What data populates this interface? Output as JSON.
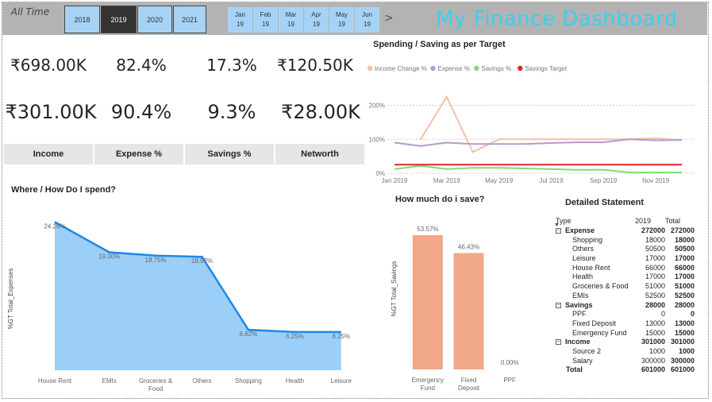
{
  "header": {
    "all_time": "All Time",
    "years": [
      "2018",
      "2019",
      "2020",
      "2021"
    ],
    "active_year": "2019",
    "months": [
      {
        "m": "Jan",
        "y": "19"
      },
      {
        "m": "Feb",
        "y": "19"
      },
      {
        "m": "Mar",
        "y": "19"
      },
      {
        "m": "Apr",
        "y": "19"
      },
      {
        "m": "May",
        "y": "19"
      },
      {
        "m": "Jun",
        "y": "19"
      }
    ],
    "next_arrow": ">",
    "title": "My Finance Dashboard"
  },
  "kpis": {
    "row1": [
      "₹698.00K",
      "82.4%",
      "17.3%",
      "₹120.50K"
    ],
    "row2": [
      "₹301.00K",
      "90.4%",
      "9.3%",
      "₹28.00K"
    ],
    "labels": [
      "Income",
      "Expense %",
      "Savings %",
      "Networth"
    ]
  },
  "colors": {
    "accent_title": "#3ad0f0",
    "year_button": "#a6d3f5",
    "active_year_button": "#333333",
    "area_fill": "#9ccff7",
    "area_line": "#1e88e5",
    "bar_fill": "#f0a889",
    "income_line": "#f5c0a8",
    "expense_line": "#b49ad4",
    "savings_line": "#7ddb77",
    "target_line": "#e8222a"
  },
  "chart_data": [
    {
      "type": "line",
      "title": "Spending / Saving as per Target",
      "legend_position": "top-left",
      "x": [
        "Jan 2019",
        "Feb 2019",
        "Mar 2019",
        "Apr 2019",
        "May 2019",
        "Jun 2019",
        "Jul 2019",
        "Aug 2019",
        "Sep 2019",
        "Oct 2019",
        "Nov 2019",
        "Dec 2019"
      ],
      "x_ticks": [
        "Jan 2019",
        "Mar 2019",
        "May 2019",
        "Jul 2019",
        "Sep 2019",
        "Nov 2019"
      ],
      "y_ticks": [
        "0%",
        "100%",
        "200%"
      ],
      "ylim": [
        0,
        220
      ],
      "grid": true,
      "series": [
        {
          "name": "Income Change %",
          "color": "#f5c0a8",
          "values": [
            null,
            100,
            225,
            62,
            100,
            100,
            100,
            100,
            100,
            100,
            103,
            97
          ]
        },
        {
          "name": "Expense %",
          "color": "#b49ad4",
          "values": [
            90,
            80,
            90,
            86,
            86,
            86,
            89,
            91,
            91,
            100,
            97,
            98
          ]
        },
        {
          "name": "Savings %",
          "color": "#7ddb77",
          "values": [
            12,
            22,
            12,
            16,
            16,
            14,
            12,
            10,
            10,
            2,
            2,
            2
          ]
        },
        {
          "name": "Savings Target",
          "color": "#e8222a",
          "values": [
            25,
            25,
            25,
            25,
            25,
            25,
            25,
            25,
            25,
            25,
            25,
            25
          ]
        }
      ]
    },
    {
      "type": "area",
      "title": "Where / How Do I spend?",
      "ylabel": "%GT Total_Expenses",
      "categories": [
        "House Rent",
        "EMIs",
        "Groceries & Food",
        "Others",
        "Shopping",
        "Health",
        "Leisure"
      ],
      "values": [
        24.26,
        19.3,
        18.75,
        18.57,
        6.62,
        6.25,
        6.25
      ],
      "labels": [
        "24.26%",
        "19.30%",
        "18.75%",
        "18.57%",
        "6.62%",
        "6.25%",
        "6.25%"
      ],
      "ylim": [
        0,
        26
      ]
    },
    {
      "type": "bar",
      "title": "How much do i save?",
      "ylabel": "%GT Total_Savings",
      "categories": [
        "Emergency Fund",
        "Fixed Deposit",
        "PPF"
      ],
      "values": [
        53.57,
        46.43,
        0.0
      ],
      "labels": [
        "53.57%",
        "46.43%",
        "0.00%"
      ],
      "ylim": [
        0,
        58
      ]
    }
  ],
  "statement": {
    "title": "Detailed Statement",
    "headers": [
      "Type",
      "2019",
      "Total"
    ],
    "rows": [
      {
        "kind": "cat",
        "label": "Expense",
        "v1": "272000",
        "v2": "272000"
      },
      {
        "kind": "item",
        "label": "Shopping",
        "v1": "18000",
        "v2": "18000"
      },
      {
        "kind": "item",
        "label": "Others",
        "v1": "50500",
        "v2": "50500"
      },
      {
        "kind": "item",
        "label": "Leisure",
        "v1": "17000",
        "v2": "17000"
      },
      {
        "kind": "item",
        "label": "House Rent",
        "v1": "66000",
        "v2": "66000"
      },
      {
        "kind": "item",
        "label": "Health",
        "v1": "17000",
        "v2": "17000"
      },
      {
        "kind": "item",
        "label": "Groceries & Food",
        "v1": "51000",
        "v2": "51000"
      },
      {
        "kind": "item",
        "label": "EMIs",
        "v1": "52500",
        "v2": "52500"
      },
      {
        "kind": "cat",
        "label": "Savings",
        "v1": "28000",
        "v2": "28000"
      },
      {
        "kind": "item",
        "label": "PPF",
        "v1": "0",
        "v2": "0"
      },
      {
        "kind": "item",
        "label": "Fixed Deposit",
        "v1": "13000",
        "v2": "13000"
      },
      {
        "kind": "item",
        "label": "Emergency Fund",
        "v1": "15000",
        "v2": "15000"
      },
      {
        "kind": "cat",
        "label": "Income",
        "v1": "301000",
        "v2": "301000"
      },
      {
        "kind": "item",
        "label": "Source 2",
        "v1": "1000",
        "v2": "1000"
      },
      {
        "kind": "item",
        "label": "Salary",
        "v1": "300000",
        "v2": "300000"
      },
      {
        "kind": "total",
        "label": "Total",
        "v1": "601000",
        "v2": "601000"
      }
    ]
  }
}
